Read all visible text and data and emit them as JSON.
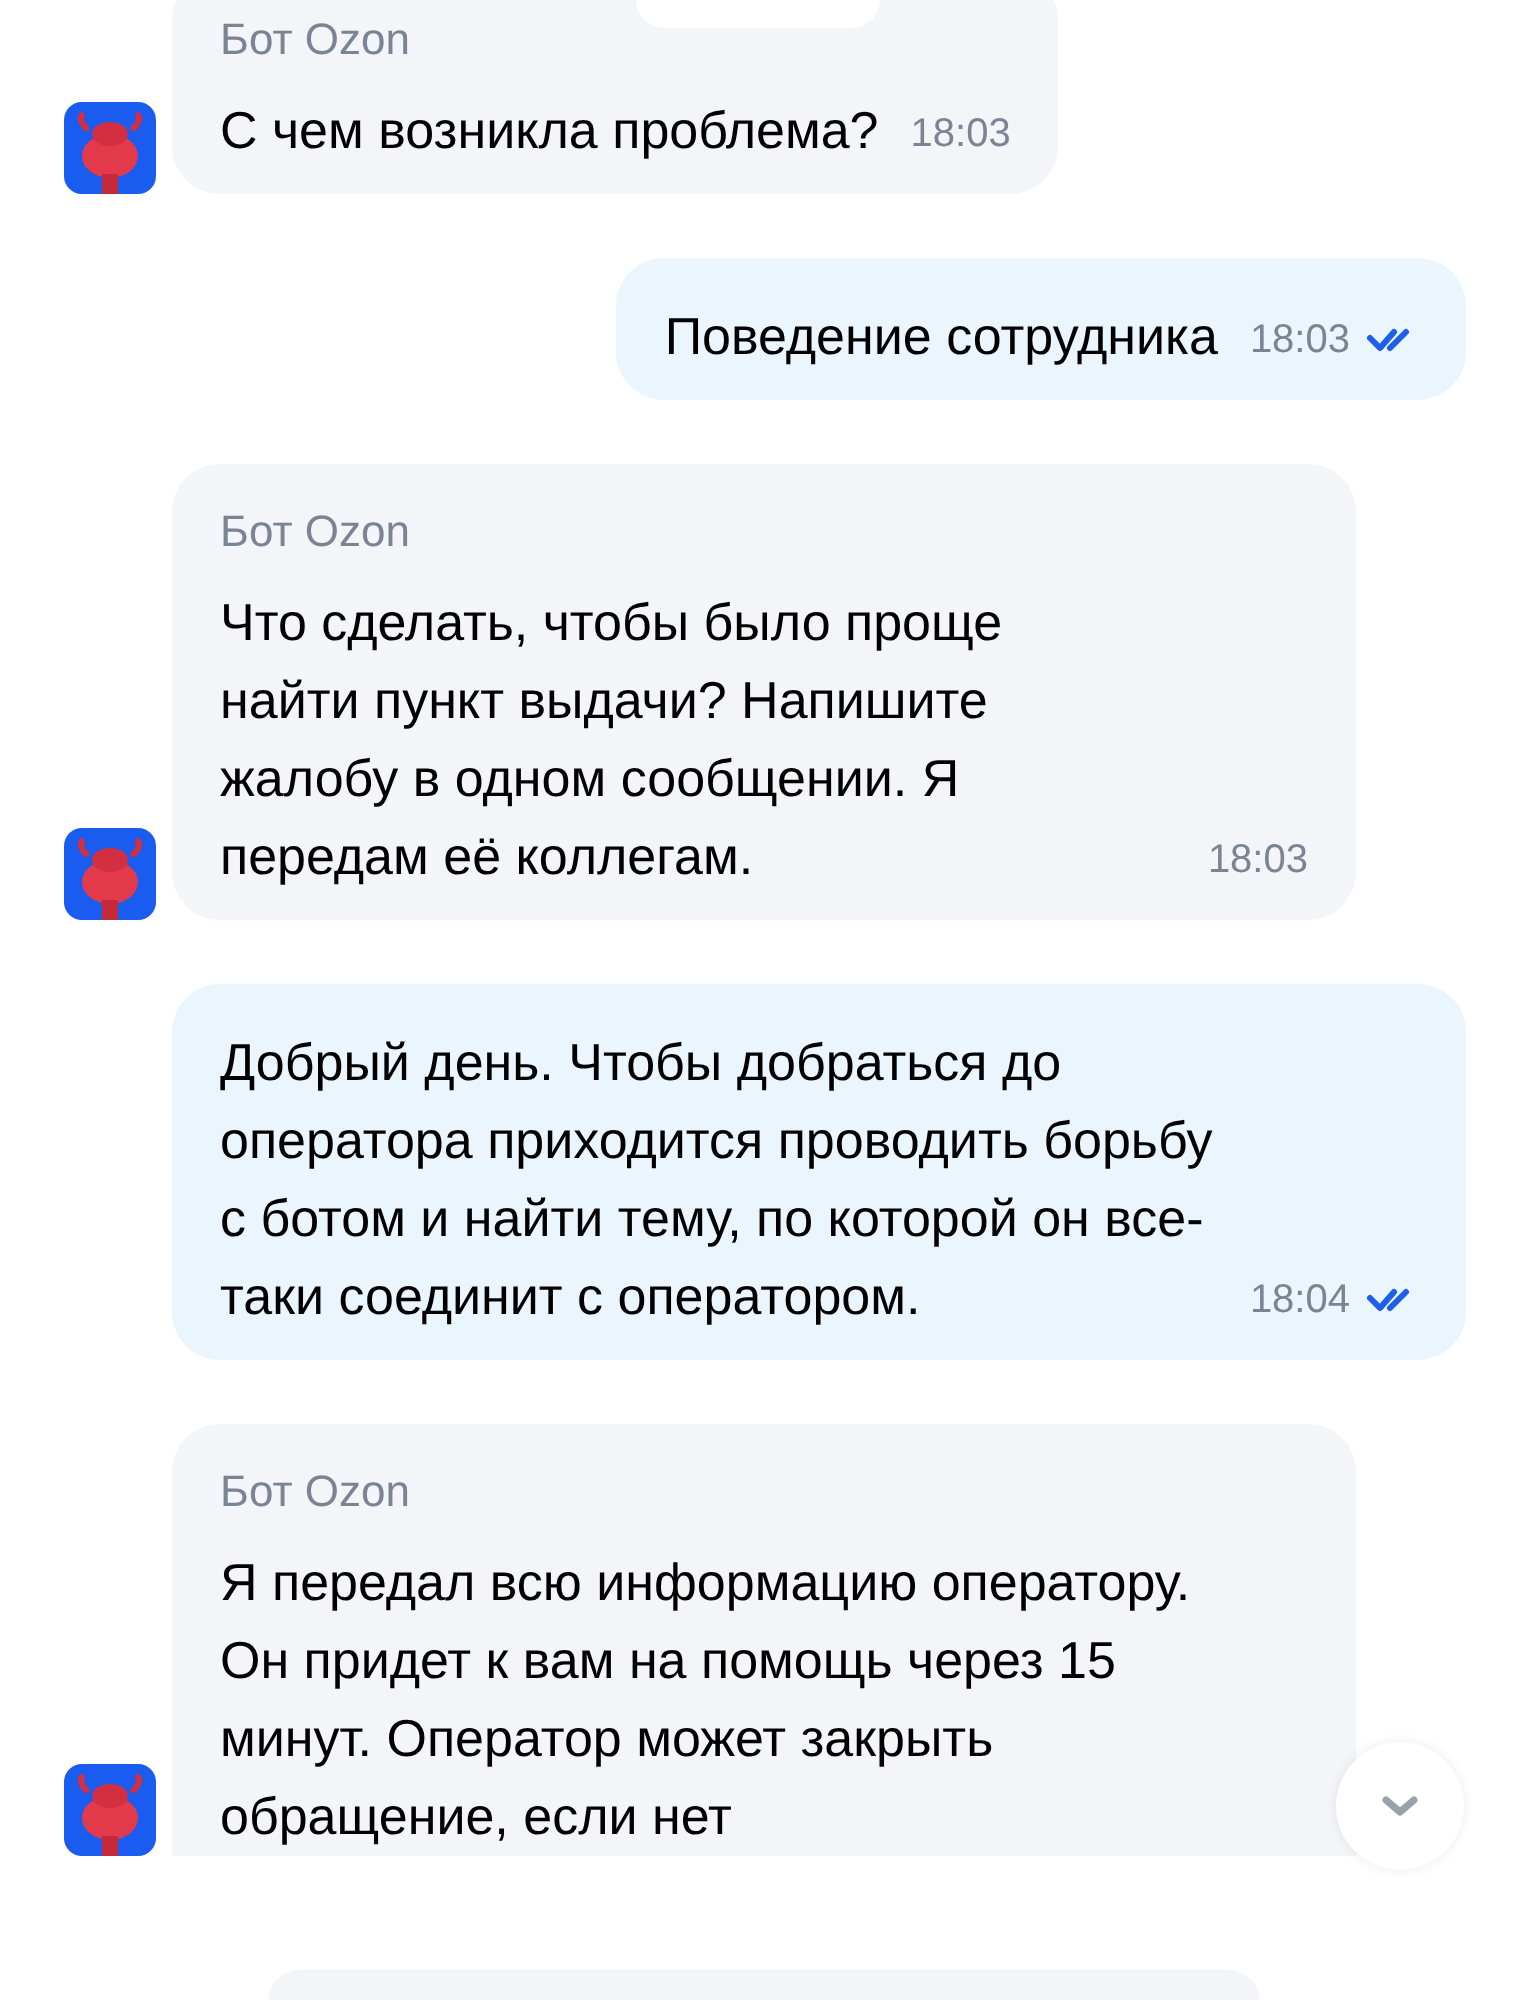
{
  "messages": [
    {
      "kind": "bot",
      "author": "Бот Ozon",
      "text": "С чем возникла проблема?",
      "time": "18:03"
    },
    {
      "kind": "user",
      "text": "Поведение сотрудника",
      "time": "18:03",
      "read": true
    },
    {
      "kind": "bot",
      "author": "Бот Ozon",
      "text": "Что сделать, чтобы было проще найти пункт выдачи? Напишите жалобу в одном сообщении. Я передам её коллегам.",
      "time": "18:03"
    },
    {
      "kind": "user",
      "text": "Добрый день. Чтобы добраться до оператора приходится проводить борьбу с ботом и найти тему, по которой он все-таки соединит с оператором.",
      "time": "18:04",
      "read": true
    },
    {
      "kind": "bot",
      "author": "Бот Ozon",
      "text": "Я передал всю информацию оператору. Он придет к вам на помощь через 15 минут. Оператор может закрыть обращение, если нет"
    }
  ]
}
